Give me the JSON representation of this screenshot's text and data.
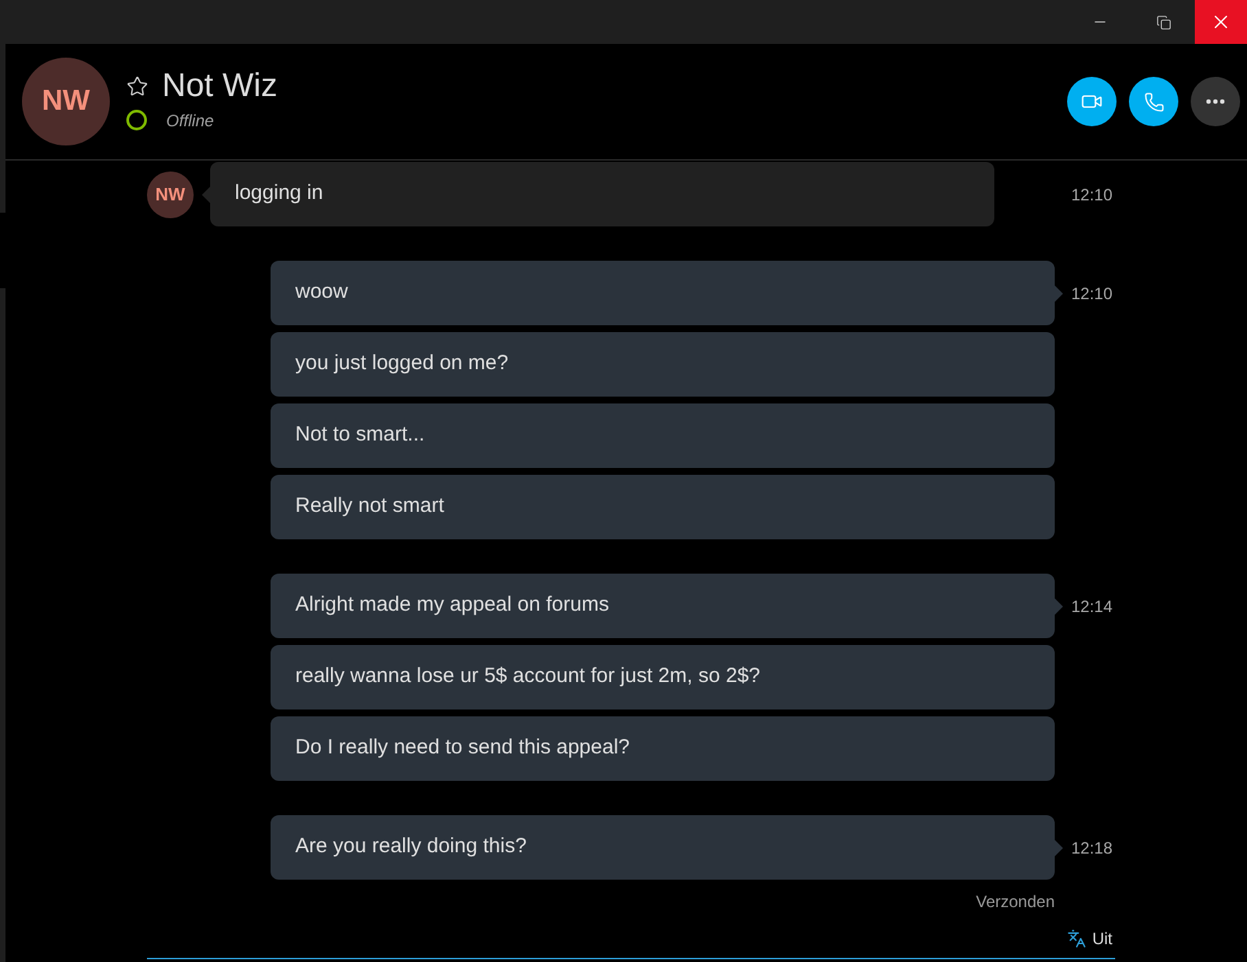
{
  "window": {
    "controls": [
      {
        "kind": "minimize"
      },
      {
        "kind": "restore"
      },
      {
        "kind": "close"
      }
    ]
  },
  "contact": {
    "initials": "NW",
    "name": "Not Wiz",
    "favorite": false,
    "status": "Offline"
  },
  "header_actions": [
    {
      "kind": "video"
    },
    {
      "kind": "call"
    },
    {
      "kind": "more"
    }
  ],
  "conversation": [
    {
      "kind": "incoming",
      "sender_initials": "NW",
      "time": "12:10",
      "messages": [
        "logging in"
      ]
    },
    {
      "kind": "outgoing",
      "time": "12:10",
      "messages": [
        "woow",
        "you just logged on me?",
        "Not to smart...",
        "Really not smart"
      ]
    },
    {
      "kind": "outgoing",
      "time": "12:14",
      "messages": [
        "Alright made my appeal on forums",
        "really wanna lose ur 5$ account for just 2m, so 2$?",
        "Do I really need to send this appeal?"
      ]
    },
    {
      "kind": "outgoing",
      "time": "12:18",
      "messages": [
        "Are you really doing this?"
      ]
    }
  ],
  "delivery_status": "Verzonden",
  "composer": {
    "translator": "Uit"
  }
}
